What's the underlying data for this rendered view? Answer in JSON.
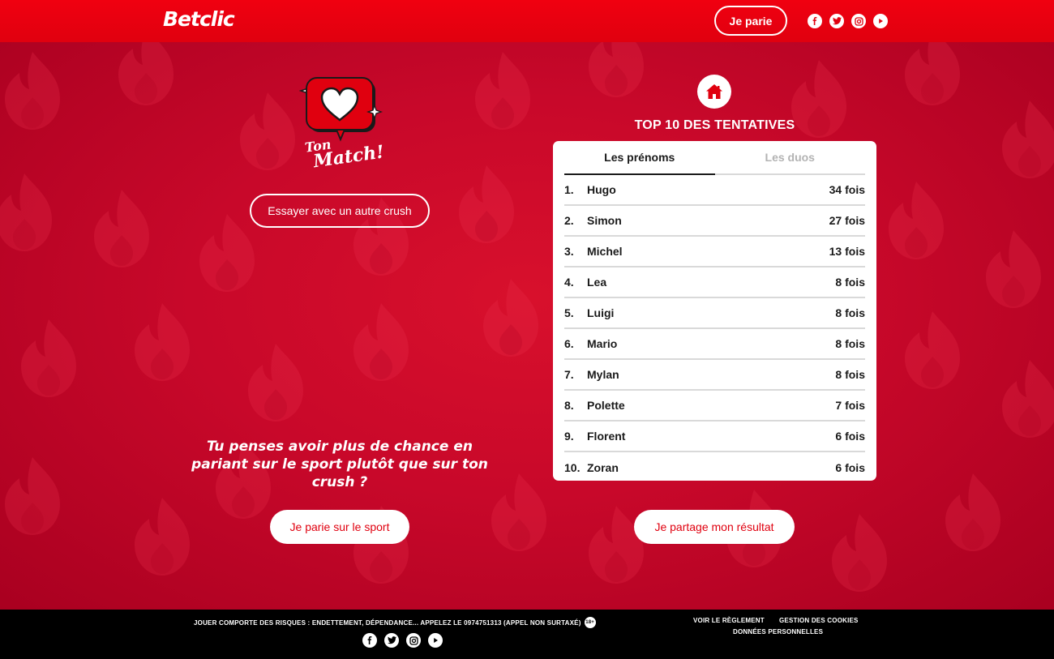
{
  "header": {
    "logo": "Betclic",
    "bet_button": "Je parie",
    "social_icons": [
      "facebook-icon",
      "twitter-icon",
      "instagram-icon",
      "youtube-icon"
    ]
  },
  "colors": {
    "brand_red": "#e0000f",
    "background_red": "#c8082a",
    "white": "#ffffff",
    "footer_black": "#000000"
  },
  "left": {
    "badge_text_line1": "Ton",
    "badge_text_line2": "Match!",
    "retry_button": "Essayer avec un autre crush",
    "tagline": "Tu penses avoir plus de chance en pariant sur le sport plutôt que sur ton crush ?",
    "sport_button": "Je parie sur le sport"
  },
  "right": {
    "home_icon": "home-icon",
    "title": "TOP 10 DES TENTATIVES",
    "tabs": [
      {
        "label": "Les prénoms",
        "active": true
      },
      {
        "label": "Les duos",
        "active": false
      }
    ],
    "rows": [
      {
        "rank": "1.",
        "name": "Hugo",
        "count": "34 fois"
      },
      {
        "rank": "2.",
        "name": "Simon",
        "count": "27 fois"
      },
      {
        "rank": "3.",
        "name": "Michel",
        "count": "13 fois"
      },
      {
        "rank": "4.",
        "name": "Lea",
        "count": "8 fois"
      },
      {
        "rank": "5.",
        "name": "Luigi",
        "count": "8 fois"
      },
      {
        "rank": "6.",
        "name": "Mario",
        "count": "8 fois"
      },
      {
        "rank": "7.",
        "name": "Mylan",
        "count": "8 fois"
      },
      {
        "rank": "8.",
        "name": "Polette",
        "count": "7 fois"
      },
      {
        "rank": "9.",
        "name": "Florent",
        "count": "6 fois"
      },
      {
        "rank": "10.",
        "name": "Zoran",
        "count": "6 fois"
      }
    ],
    "share_button": "Je partage mon résultat"
  },
  "footer": {
    "risk_text": "JOUER COMPORTE DES RISQUES : ENDETTEMENT, DÉPENDANCE... APPELEZ LE 0974751313 (APPEL NON SURTAXÉ)",
    "age_badge": "18+",
    "link_reglement": "VOIR LE RÈGLEMENT",
    "link_cookies": "GESTION DES COOKIES",
    "link_donnees": "DONNÉES PERSONNELLES"
  }
}
